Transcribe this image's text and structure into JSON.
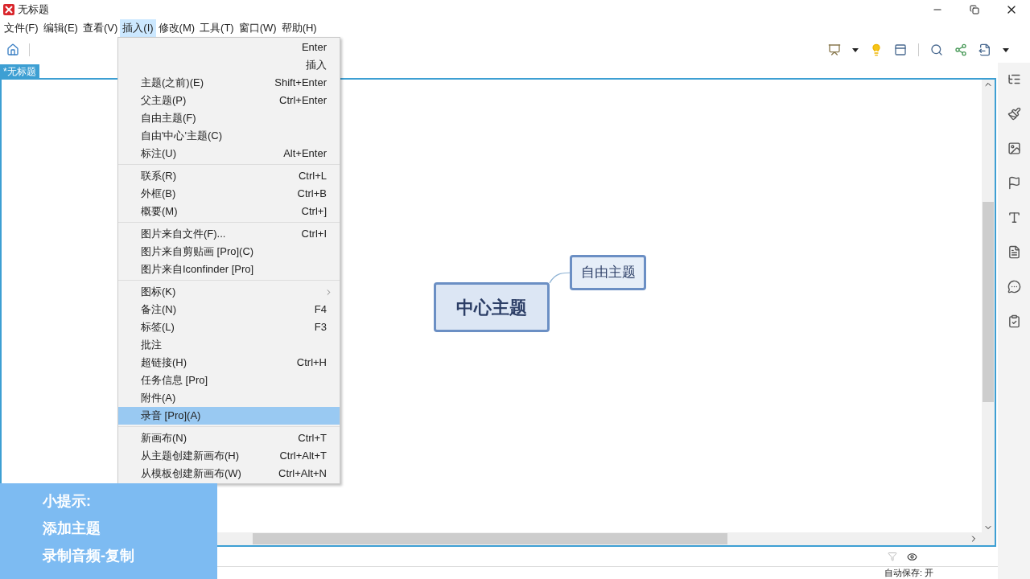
{
  "window": {
    "title": "无标题"
  },
  "menubar": [
    {
      "label": "文件(F)",
      "selected": false
    },
    {
      "label": "编辑(E)",
      "selected": false
    },
    {
      "label": "查看(V)",
      "selected": false
    },
    {
      "label": "插入(I)",
      "selected": true
    },
    {
      "label": "修改(M)",
      "selected": false
    },
    {
      "label": "工具(T)",
      "selected": false
    },
    {
      "label": "窗口(W)",
      "selected": false
    },
    {
      "label": "帮助(H)",
      "selected": false
    }
  ],
  "tab": {
    "label": "*无标题",
    "selected": true
  },
  "menu": {
    "groups": [
      [
        {
          "shortcut": "Enter",
          "selected": false
        },
        {
          "shortcut": "插入",
          "selected": false
        },
        {
          "label": "主题(之前)(E)",
          "shortcut": "Shift+Enter",
          "selected": false
        },
        {
          "label": "父主题(P)",
          "shortcut": "Ctrl+Enter",
          "selected": false
        },
        {
          "label": "自由主题(F)",
          "selected": false
        },
        {
          "label": "自由'中心'主题(C)",
          "selected": false
        },
        {
          "label": "标注(U)",
          "shortcut": "Alt+Enter",
          "selected": false
        }
      ],
      [
        {
          "label": "联系(R)",
          "shortcut": "Ctrl+L",
          "selected": false
        },
        {
          "label": "外框(B)",
          "shortcut": "Ctrl+B",
          "selected": false
        },
        {
          "label": "概要(M)",
          "shortcut": "Ctrl+]",
          "selected": false
        }
      ],
      [
        {
          "label": "图片来自文件(F)...",
          "shortcut": "Ctrl+I",
          "selected": false
        },
        {
          "label": "图片来自剪贴画 [Pro](C)",
          "selected": false
        },
        {
          "label": "图片来自Iconfinder [Pro]",
          "selected": false
        }
      ],
      [
        {
          "label": "图标(K)",
          "submenu": true,
          "selected": false
        },
        {
          "label": "备注(N)",
          "shortcut": "F4",
          "selected": false
        },
        {
          "label": "标签(L)",
          "shortcut": "F3",
          "selected": false
        },
        {
          "label": "批注",
          "selected": false
        },
        {
          "label": "超链接(H)",
          "shortcut": "Ctrl+H",
          "selected": false
        },
        {
          "label": "任务信息 [Pro]",
          "selected": false
        },
        {
          "label": "附件(A)",
          "selected": false
        },
        {
          "label": "录音 [Pro](A)",
          "selected": true
        }
      ],
      [
        {
          "label": "新画布(N)",
          "shortcut": "Ctrl+T",
          "selected": false
        },
        {
          "label": "从主题创建新画布(H)",
          "shortcut": "Ctrl+Alt+T",
          "selected": false
        },
        {
          "label": "从模板创建新画布(W)",
          "shortcut": "Ctrl+Alt+N",
          "selected": false
        }
      ]
    ]
  },
  "canvas": {
    "central_topic": "中心主题",
    "floating_topic": "自由主题"
  },
  "status_bar": {
    "autosave": "自动保存: 开"
  },
  "tip_overlay": {
    "lines": [
      "小提示:",
      "添加主题",
      "录制音频-复制"
    ]
  }
}
